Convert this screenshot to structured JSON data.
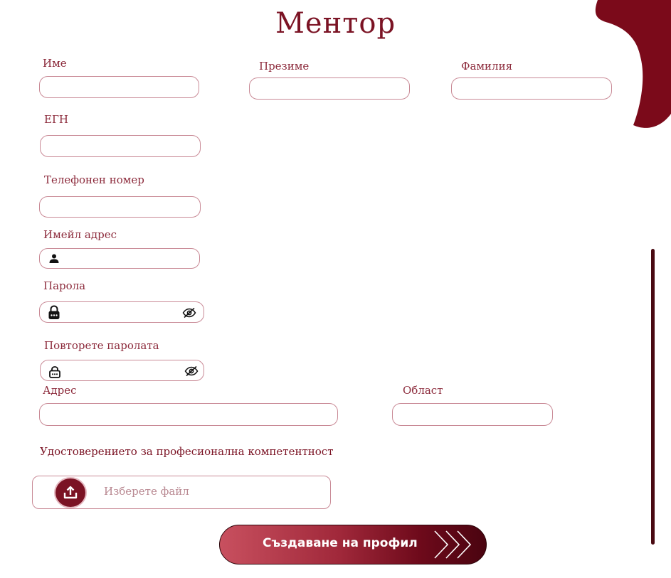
{
  "page_title": "Ментор",
  "fields": {
    "first_name": {
      "label": "Име",
      "value": ""
    },
    "middle_name": {
      "label": "Презиме",
      "value": ""
    },
    "last_name": {
      "label": "Фамилия",
      "value": ""
    },
    "egn": {
      "label": "ЕГН",
      "value": ""
    },
    "phone": {
      "label": "Телефонен номер",
      "value": ""
    },
    "email": {
      "label": "Имейл адрес",
      "value": "",
      "icon": "user-icon"
    },
    "password": {
      "label": "Парола",
      "value": "",
      "icon": "lock-icon",
      "toggle_icon": "eye-off-icon"
    },
    "repeat_password": {
      "label": "Повторете паролата",
      "value": "",
      "icon": "lock-icon",
      "toggle_icon": "eye-off-icon"
    },
    "address": {
      "label": "Адрес",
      "value": ""
    },
    "region": {
      "label": "Област",
      "value": ""
    }
  },
  "certificate": {
    "label": "Удостоверението за професионална компетентност",
    "upload_text": "Изберете файл",
    "icon": "upload-icon"
  },
  "submit_label": "Създаване на профил",
  "colors": {
    "brand": "#7b1324",
    "input_border": "#c98a96",
    "scrollbar": "#4a0a12"
  }
}
